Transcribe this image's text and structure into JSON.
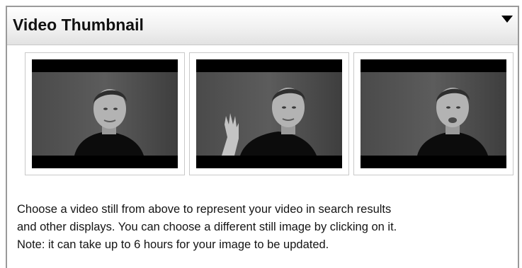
{
  "panel": {
    "title": "Video Thumbnail",
    "collapse_icon": "triangle-down-icon"
  },
  "thumbnails": [
    {
      "id": "still-1",
      "pose": "neutral"
    },
    {
      "id": "still-2",
      "pose": "waving"
    },
    {
      "id": "still-3",
      "pose": "talking"
    }
  ],
  "description": {
    "line1": "Choose a video still from above to represent your video in search results",
    "line2": "and other displays. You can choose a different still image by clicking on it.",
    "line3": "Note: it can take up to 6 hours for your image to be updated."
  },
  "colors": {
    "header_bg": "#e6e6e6",
    "border": "#9a9a9a",
    "text": "#141414"
  }
}
